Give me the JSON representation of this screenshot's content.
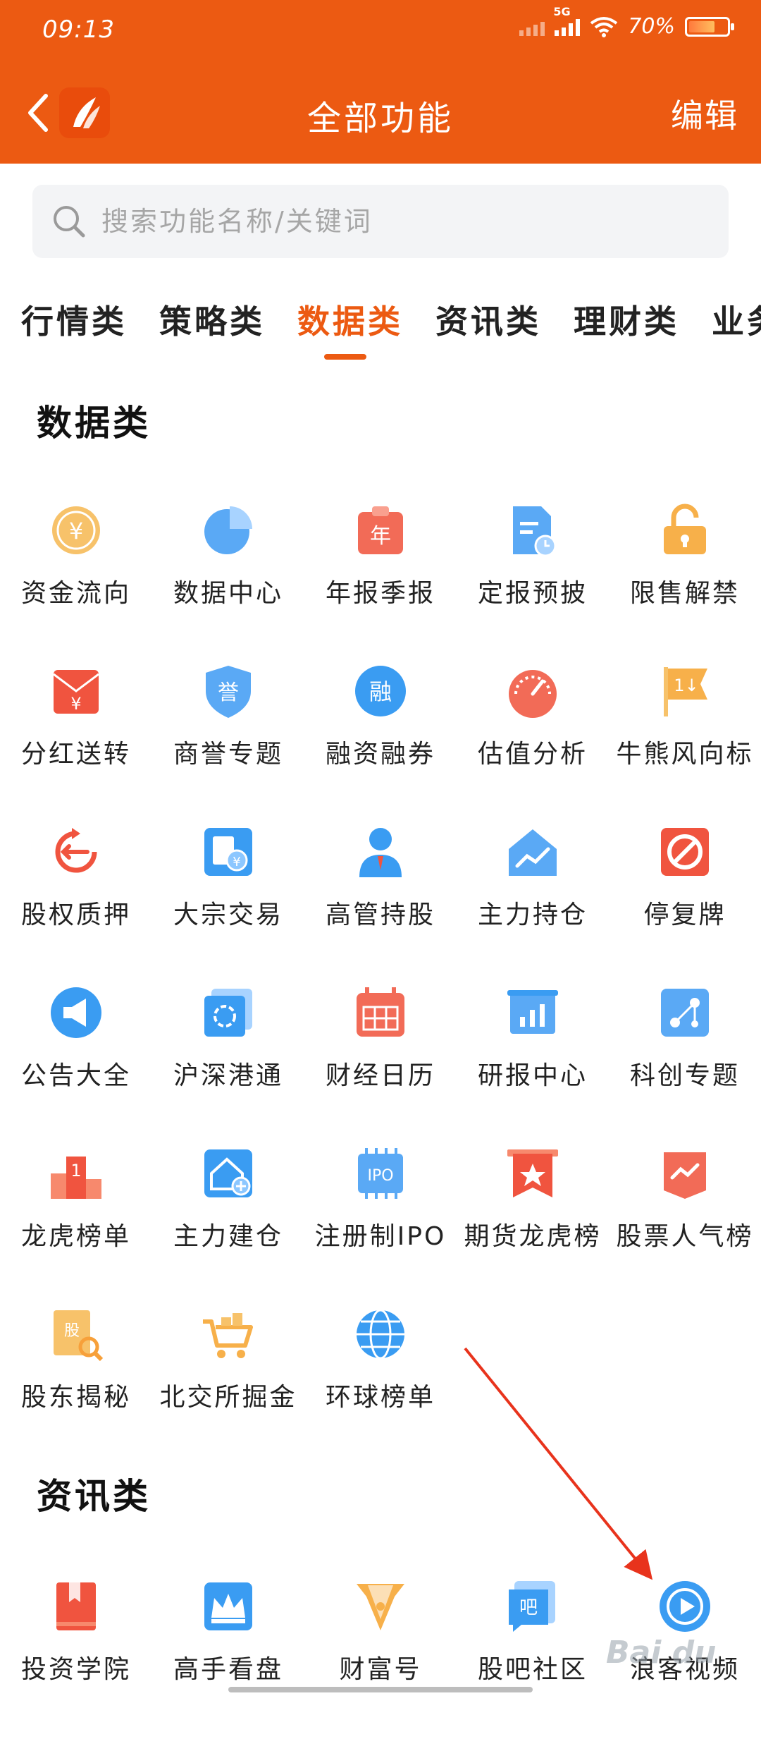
{
  "status_bar": {
    "time": "09:13",
    "network": "5G",
    "battery": "70%"
  },
  "header": {
    "title": "全部功能",
    "edit_label": "编辑"
  },
  "search": {
    "placeholder": "搜索功能名称/关键词"
  },
  "tabs": [
    {
      "label": "行情类",
      "active": false
    },
    {
      "label": "策略类",
      "active": false
    },
    {
      "label": "数据类",
      "active": true
    },
    {
      "label": "资讯类",
      "active": false
    },
    {
      "label": "理财类",
      "active": false
    },
    {
      "label": "业务",
      "active": false
    }
  ],
  "sections": [
    {
      "title": "数据类",
      "items": [
        {
          "label": "资金流向",
          "icon": "coin-yen-icon"
        },
        {
          "label": "数据中心",
          "icon": "pie-chart-icon"
        },
        {
          "label": "年报季报",
          "icon": "calendar-year-icon"
        },
        {
          "label": "定报预披",
          "icon": "document-clock-icon"
        },
        {
          "label": "限售解禁",
          "icon": "unlock-icon"
        },
        {
          "label": "分红送转",
          "icon": "red-envelope-icon"
        },
        {
          "label": "商誉专题",
          "icon": "shield-badge-icon"
        },
        {
          "label": "融资融券",
          "icon": "margin-trading-icon"
        },
        {
          "label": "估值分析",
          "icon": "gauge-icon"
        },
        {
          "label": "牛熊风向标",
          "icon": "flag-arrows-icon"
        },
        {
          "label": "股权质押",
          "icon": "pledge-arrow-icon"
        },
        {
          "label": "大宗交易",
          "icon": "block-trade-icon"
        },
        {
          "label": "高管持股",
          "icon": "executive-icon"
        },
        {
          "label": "主力持仓",
          "icon": "house-chart-icon"
        },
        {
          "label": "停复牌",
          "icon": "no-entry-icon"
        },
        {
          "label": "公告大全",
          "icon": "megaphone-icon"
        },
        {
          "label": "沪深港通",
          "icon": "hk-flower-icon"
        },
        {
          "label": "财经日历",
          "icon": "calendar-icon"
        },
        {
          "label": "研报中心",
          "icon": "bar-chart-board-icon"
        },
        {
          "label": "科创专题",
          "icon": "node-link-icon"
        },
        {
          "label": "龙虎榜单",
          "icon": "podium-icon"
        },
        {
          "label": "主力建仓",
          "icon": "house-plus-icon"
        },
        {
          "label": "注册制IPO",
          "icon": "ipo-chip-icon"
        },
        {
          "label": "期货龙虎榜",
          "icon": "star-banner-icon"
        },
        {
          "label": "股票人气榜",
          "icon": "trend-banner-icon"
        },
        {
          "label": "股东揭秘",
          "icon": "shareholder-book-icon"
        },
        {
          "label": "北交所掘金",
          "icon": "gold-cart-icon"
        },
        {
          "label": "环球榜单",
          "icon": "globe-icon"
        }
      ]
    },
    {
      "title": "资讯类",
      "items": [
        {
          "label": "投资学院",
          "icon": "book-bookmark-icon"
        },
        {
          "label": "高手看盘",
          "icon": "crown-icon"
        },
        {
          "label": "财富号",
          "icon": "pen-nib-icon"
        },
        {
          "label": "股吧社区",
          "icon": "chat-bar-icon"
        },
        {
          "label": "浪客视频",
          "icon": "play-video-icon"
        }
      ]
    }
  ],
  "watermark": "Bai du"
}
